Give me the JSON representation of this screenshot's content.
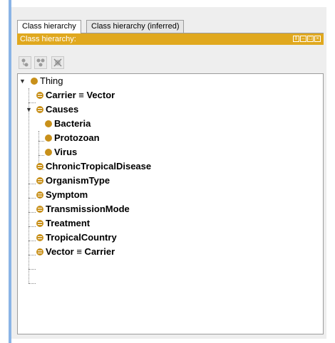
{
  "tabs": [
    {
      "label": "Class hierarchy",
      "active": true
    },
    {
      "label": "Class hierarchy (inferred)",
      "active": false
    }
  ],
  "view": {
    "title": "Class hierarchy:",
    "title_bg": "#e0a81e",
    "toolbar": [
      {
        "icon": "add-subclass-icon"
      },
      {
        "icon": "add-sibling-class-icon"
      },
      {
        "icon": "delete-class-icon"
      }
    ],
    "window_controls": [
      "pin-icon",
      "minimize-icon",
      "maximize-icon",
      "close-icon"
    ]
  },
  "tree": {
    "root": {
      "label": "Thing",
      "expanded": true
    },
    "nodes": [
      {
        "label": "Carrier ≡ Vector",
        "level": 1,
        "equivalent": true
      },
      {
        "label": "Causes",
        "level": 1,
        "equivalent": true,
        "expanded": true
      },
      {
        "label": "Bacteria",
        "level": 2,
        "equivalent": false
      },
      {
        "label": "Protozoan",
        "level": 2,
        "equivalent": false
      },
      {
        "label": "Virus",
        "level": 2,
        "equivalent": false
      },
      {
        "label": "ChronicTropicalDisease",
        "level": 1,
        "equivalent": true
      },
      {
        "label": "OrganismType",
        "level": 1,
        "equivalent": true
      },
      {
        "label": "Symptom",
        "level": 1,
        "equivalent": true
      },
      {
        "label": "TransmissionMode",
        "level": 1,
        "equivalent": true
      },
      {
        "label": "Treatment",
        "level": 1,
        "equivalent": true
      },
      {
        "label": "TropicalCountry",
        "level": 1,
        "equivalent": true
      },
      {
        "label": "Vector ≡ Carrier",
        "level": 1,
        "equivalent": true
      }
    ]
  }
}
